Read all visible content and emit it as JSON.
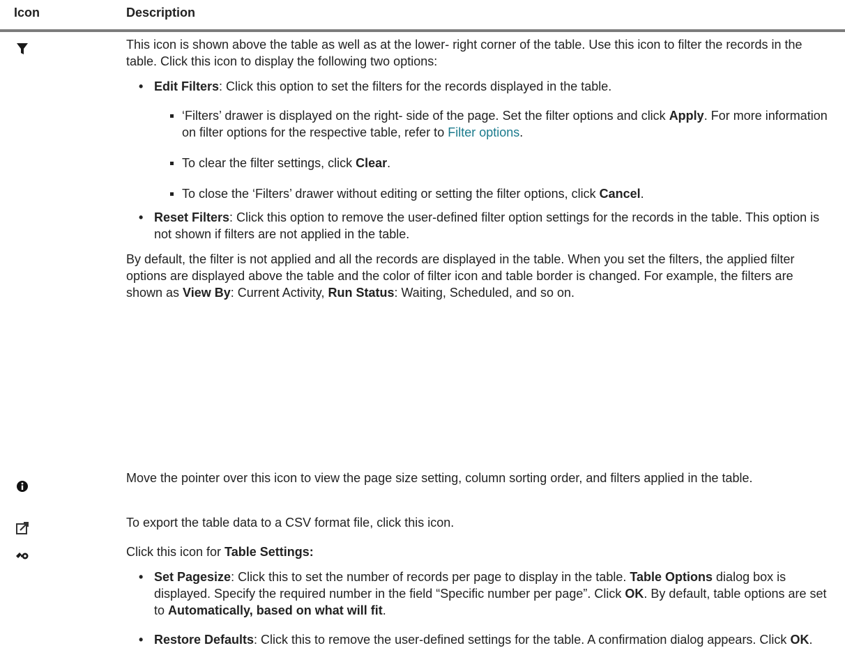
{
  "header": {
    "icon_col": "Icon",
    "description_col": "Description"
  },
  "rows": [
    {
      "icon": "filter-icon",
      "intro": "This icon is shown above the table as well as at the lower- right corner of the table. Use this icon to filter the records in the table. Click this icon to display the following two options:",
      "edit_filters": {
        "title": "Edit Filters",
        "text": ": Click this option to set the filters for the records displayed in the table.",
        "sub": [
          {
            "pre": "‘Filters’ drawer is displayed on the right- side of the page. Set the filter options and click ",
            "bold": "Apply",
            "mid": ". For more information on filter options for the respective table, refer to ",
            "link": "Filter options",
            "post": "."
          },
          {
            "pre": "To clear the filter settings, click ",
            "bold": "Clear",
            "post": "."
          },
          {
            "pre": "To close the ‘Filters’ drawer without editing or setting the filter options, click ",
            "bold": "Cancel",
            "post": "."
          }
        ]
      },
      "reset_filters": {
        "title": "Reset Filters",
        "text": ": Click this option to remove the user-defined filter option settings for the records in the table. This option is not shown if filters are not applied in the table."
      },
      "outro": {
        "pre": "By default, the filter is not applied and all the records are displayed in the table. When you set the filters, the applied filter options are displayed above the table and the color of filter icon and table border is changed. For example, the filters are shown as ",
        "b1": "View By",
        "t1": ": Current Activity, ",
        "b2": "Run Status",
        "t2": ": Waiting, Scheduled, and so on."
      }
    },
    {
      "icon": "info-icon",
      "text": "Move the pointer over this icon to view the page size setting, column sorting order, and filters applied in the table."
    },
    {
      "icon": "export-icon",
      "text": "To export the table data to a CSV format file, click this icon."
    },
    {
      "icon": "wrench-icon",
      "intro_pre": "Click this icon for ",
      "intro_bold": "Table Settings:",
      "set_pagesize": {
        "title": "Set Pagesize",
        "t1": ": Click this to set the number of records per page to display in the table. ",
        "b1": "Table Options",
        "t2": " dialog box is displayed. Specify the required number in the field “Specific number per page”. Click ",
        "b2": "OK",
        "t3": ". By default, table options are set to ",
        "b3": "Automatically, based on what will fit",
        "t4": "."
      },
      "restore_defaults": {
        "title": "Restore Defaults",
        "t1": ": Click this to remove the user-defined settings for the table. A confirmation dialog appears. Click ",
        "b1": "OK",
        "t2": "."
      }
    }
  ]
}
